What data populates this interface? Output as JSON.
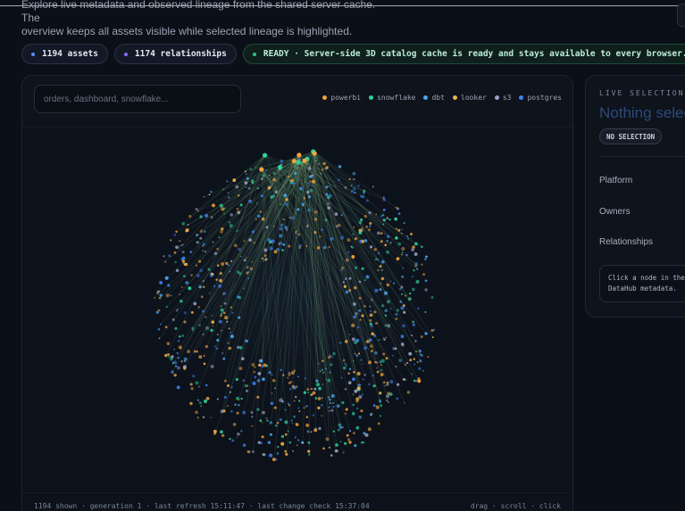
{
  "intro": {
    "line1": "Explore live metadata and observed lineage from the shared server cache. The",
    "line2": "overview keeps all assets visible while selected lineage is highlighted."
  },
  "stats": {
    "assets": "1194 assets",
    "relationships": "1174 relationships",
    "ready": "READY · Server-side 3D catalog cache is ready and stays available to every browser."
  },
  "colors": {
    "assets_dot": "#5b8def",
    "relationships_dot": "#8b6cf0",
    "ready_dot": "#2fbf8f"
  },
  "search": {
    "placeholder": "orders, dashboard, snowflake..."
  },
  "legend": [
    {
      "label": "powerbi",
      "color": "#f2a33a"
    },
    {
      "label": "snowflake",
      "color": "#2fd39a"
    },
    {
      "label": "dbt",
      "color": "#4aa8f0"
    },
    {
      "label": "looker",
      "color": "#f2b24a"
    },
    {
      "label": "s3",
      "color": "#9aa4c4"
    },
    {
      "label": "postgres",
      "color": "#3f84f2"
    }
  ],
  "graph": {
    "shown": 1194,
    "relationships": 1174
  },
  "footer": {
    "status": "1194 shown · generation 1 · last refresh 15:11:47 · last change check 15:37:04",
    "controls": "drag · scroll · click"
  },
  "selection": {
    "label": "LIVE SELECTION",
    "title": "Nothing selected",
    "badge": "NO SELECTION",
    "platform": "Platform",
    "owners": "Owners",
    "relationships": "Relationships",
    "hint_line1": "Click a node in the graph to inspect",
    "hint_line2": "DataHub metadata."
  }
}
